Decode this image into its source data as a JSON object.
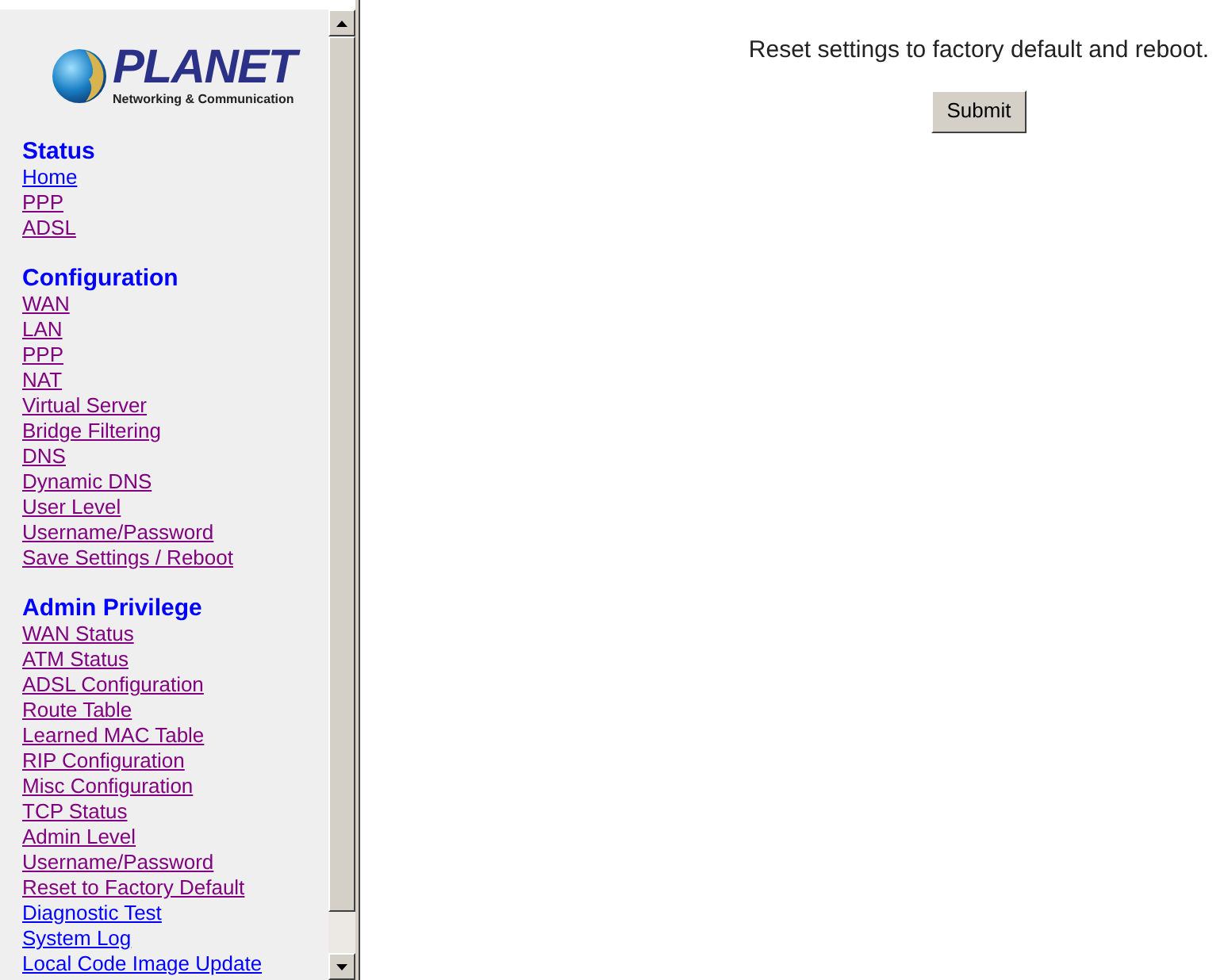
{
  "logo": {
    "name": "PLANET",
    "tagline": "Networking & Communication"
  },
  "sidebar": {
    "sections": [
      {
        "title": "Status",
        "links": [
          {
            "label": "Home",
            "visited": false
          },
          {
            "label": "PPP",
            "visited": true
          },
          {
            "label": "ADSL",
            "visited": true
          }
        ]
      },
      {
        "title": "Configuration",
        "links": [
          {
            "label": "WAN",
            "visited": true
          },
          {
            "label": "LAN",
            "visited": true
          },
          {
            "label": "PPP",
            "visited": true
          },
          {
            "label": "NAT",
            "visited": true
          },
          {
            "label": "Virtual Server",
            "visited": true
          },
          {
            "label": "Bridge Filtering",
            "visited": true
          },
          {
            "label": "DNS",
            "visited": true
          },
          {
            "label": "Dynamic DNS",
            "visited": true
          },
          {
            "label": "User Level",
            "visited": true
          },
          {
            "label": "Username/Password",
            "visited": true
          },
          {
            "label": "Save Settings / Reboot",
            "visited": true
          }
        ]
      },
      {
        "title": "Admin Privilege",
        "links": [
          {
            "label": "WAN Status",
            "visited": true
          },
          {
            "label": "ATM Status",
            "visited": true
          },
          {
            "label": "ADSL Configuration",
            "visited": true
          },
          {
            "label": "Route Table",
            "visited": true
          },
          {
            "label": "Learned MAC Table",
            "visited": true
          },
          {
            "label": "RIP Configuration",
            "visited": true
          },
          {
            "label": "Misc Configuration",
            "visited": true
          },
          {
            "label": "TCP Status",
            "visited": true
          },
          {
            "label": "Admin Level",
            "visited": true
          },
          {
            "label": "Username/Password",
            "visited": true
          },
          {
            "label": "Reset to Factory Default",
            "visited": true
          },
          {
            "label": "Diagnostic Test",
            "visited": false
          },
          {
            "label": "System Log",
            "visited": false
          },
          {
            "label": "Local Code Image Update",
            "visited": false
          }
        ]
      }
    ]
  },
  "main": {
    "message": "Reset settings to factory default and reboot.",
    "button": "Submit"
  }
}
